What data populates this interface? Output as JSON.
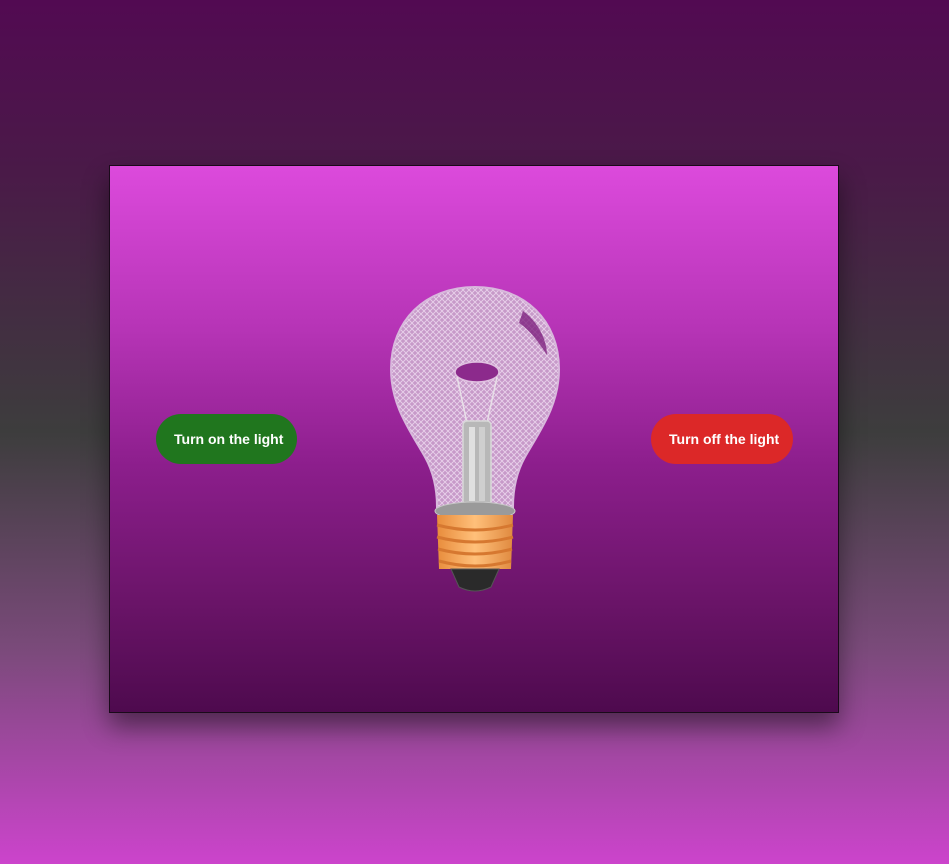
{
  "controls": {
    "turn_on_label": "Turn on the light",
    "turn_off_label": "Turn off the light"
  },
  "bulb": {
    "state": "off",
    "icon": "lightbulb-icon"
  },
  "colors": {
    "on_button": "#20761e",
    "off_button": "#dc2828",
    "panel_top": "#dc4adc",
    "panel_bottom": "#4e0a4e",
    "bulb_base": "#f0a050"
  }
}
